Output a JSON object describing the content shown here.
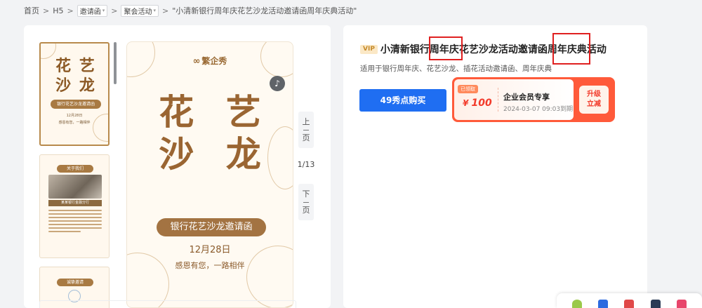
{
  "breadcrumb": {
    "home": "首页",
    "h5": "H5",
    "category": "邀请函",
    "subcategory": "聚会活动",
    "current": "\"小清新银行周年庆花艺沙龙活动邀请函周年庆典活动\"",
    "separator": ">"
  },
  "preview": {
    "logo_text": "繁企秀",
    "title_line1": "花 艺",
    "title_line2": "沙 龙",
    "banner": "银行花艺沙龙邀请函",
    "date": "12月28日",
    "thanks": "感恩有您，一路相伴",
    "prev_label": [
      "上",
      "页"
    ],
    "next_label": [
      "下",
      "页"
    ],
    "page_indicator": "1/13"
  },
  "thumbnails": [
    {
      "title_line1": "花 艺",
      "title_line2": "沙 龙",
      "banner": "银行花艺沙龙邀请函",
      "date": "12月28日",
      "thanks": "感恩有您，一路相伴"
    },
    {
      "header": "关于我们",
      "caption": "某某银行金融分行"
    },
    {
      "header": "诚挚邀请"
    }
  ],
  "detail": {
    "vip_badge": "VIP",
    "title": "小清新银行周年庆花艺沙龙活动邀请函周年庆典活动",
    "subtitle": "适用于银行周年庆、花艺沙龙、插花活动邀请函、周年庆典",
    "buy_button": "49秀点购买"
  },
  "coupon": {
    "tag": "已领取",
    "currency": "¥",
    "amount": "100",
    "name": "企业会员专享",
    "expire": "2024-03-07 09:03到期",
    "upgrade_line1": "升级",
    "upgrade_line2": "立减"
  },
  "colors": {
    "accent_blue": "#1f6ef2",
    "coupon_red": "#ff5a3a",
    "gold_brown": "#9a6532",
    "highlight_red": "#e02020"
  }
}
